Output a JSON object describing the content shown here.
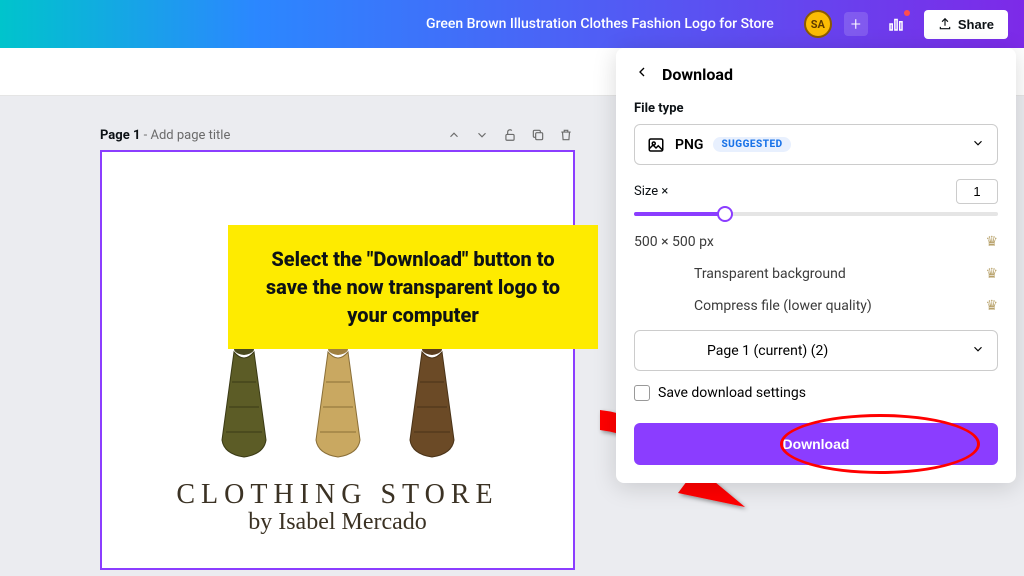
{
  "header": {
    "doc_title": "Green Brown Illustration Clothes Fashion Logo for Store",
    "avatar_initials": "SA",
    "share_label": "Share"
  },
  "page": {
    "label": "Page 1",
    "placeholder": "Add page title"
  },
  "logo": {
    "store_name": "CLOTHING STORE",
    "byline": "by Isabel Mercado"
  },
  "download_panel": {
    "title": "Download",
    "filetype_label": "File type",
    "filetype_value": "PNG",
    "suggested_badge": "SUGGESTED",
    "size_label": "Size ×",
    "size_value": "1",
    "dimensions_text": "500 × 500 px",
    "transparent_bg_option": "Transparent background",
    "compress_option": "Compress file (lower quality)",
    "page_selected": "Page 1 (current) (2)",
    "save_settings_label": "Save download settings",
    "download_button": "Download"
  },
  "callout": {
    "text": "Select the \"Download\" button to save the now transparent logo to your computer"
  }
}
